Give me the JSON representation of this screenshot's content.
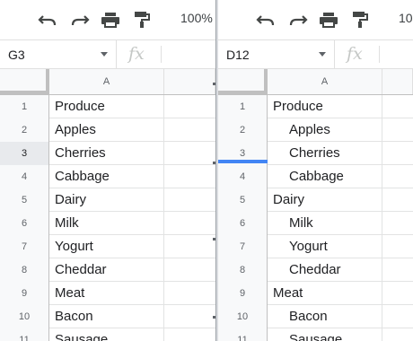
{
  "left_pane": {
    "toolbar": {
      "zoom": "100%"
    },
    "name_box": "G3",
    "fx_label": "fx",
    "column_header": "A",
    "selected_row": 3,
    "rows": [
      {
        "num": "1",
        "value": "Produce"
      },
      {
        "num": "2",
        "value": "Apples"
      },
      {
        "num": "3",
        "value": "Cherries"
      },
      {
        "num": "4",
        "value": "Cabbage"
      },
      {
        "num": "5",
        "value": "Dairy"
      },
      {
        "num": "6",
        "value": "Milk"
      },
      {
        "num": "7",
        "value": "Yogurt"
      },
      {
        "num": "8",
        "value": "Cheddar"
      },
      {
        "num": "9",
        "value": "Meat"
      },
      {
        "num": "10",
        "value": "Bacon"
      },
      {
        "num": "11",
        "value": "Sausage"
      }
    ]
  },
  "right_pane": {
    "toolbar": {
      "zoom": "10"
    },
    "name_box": "D12",
    "fx_label": "fx",
    "column_header": "A",
    "rows": [
      {
        "num": "1",
        "value": "Produce",
        "indent": 0
      },
      {
        "num": "2",
        "value": "Apples",
        "indent": 1
      },
      {
        "num": "3",
        "value": "Cherries",
        "indent": 1
      },
      {
        "num": "4",
        "value": "Cabbage",
        "indent": 1
      },
      {
        "num": "5",
        "value": "Dairy",
        "indent": 0
      },
      {
        "num": "6",
        "value": "Milk",
        "indent": 1
      },
      {
        "num": "7",
        "value": "Yogurt",
        "indent": 1
      },
      {
        "num": "8",
        "value": "Cheddar",
        "indent": 1
      },
      {
        "num": "9",
        "value": "Meat",
        "indent": 0
      },
      {
        "num": "10",
        "value": "Bacon",
        "indent": 1
      },
      {
        "num": "11",
        "value": "Sausage",
        "indent": 1
      }
    ]
  },
  "icons": [
    "undo-icon",
    "redo-icon",
    "print-icon",
    "paint-format-icon",
    "fx-icon"
  ],
  "colors": {
    "header_bg": "#f8f9fa",
    "drop_indicator": "#4285f4",
    "text": "#202124",
    "muted": "#5f6368"
  }
}
